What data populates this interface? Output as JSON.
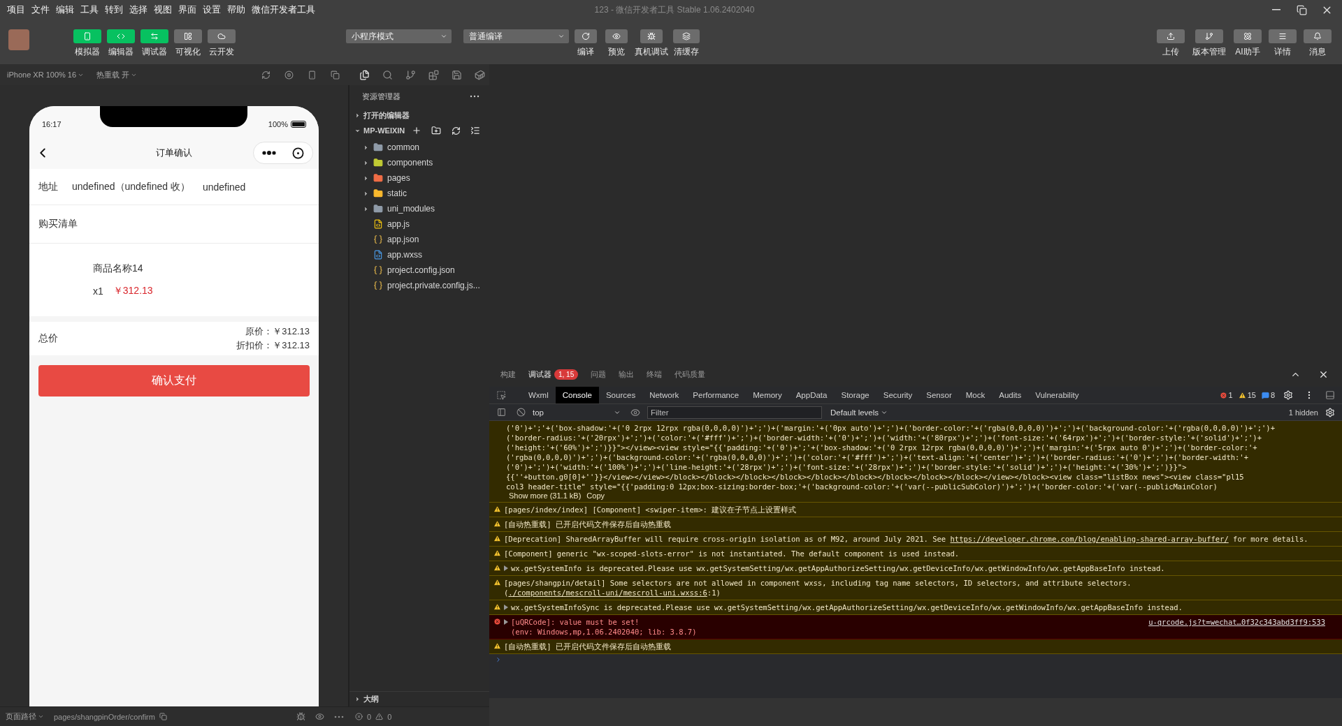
{
  "menu_bar": {
    "items": [
      "项目",
      "文件",
      "编辑",
      "工具",
      "转到",
      "选择",
      "视图",
      "界面",
      "设置",
      "帮助",
      "微信开发者工具"
    ],
    "title": "123 - 微信开发者工具 Stable 1.06.2402040"
  },
  "toolbar": {
    "view_buttons": [
      {
        "label": "模拟器",
        "on": true
      },
      {
        "label": "编辑器",
        "on": true
      },
      {
        "label": "调试器",
        "on": true
      },
      {
        "label": "可视化",
        "on": false
      },
      {
        "label": "云开发",
        "on": false
      }
    ],
    "mode_select": "小程序模式",
    "compile_select": "普通编译",
    "actions": [
      "编译",
      "预览",
      "真机调试",
      "清缓存"
    ],
    "right_actions": [
      "上传",
      "版本管理",
      "AI助手",
      "详情",
      "消息"
    ]
  },
  "simulator": {
    "device": "iPhone XR 100% 16",
    "hot_reload": "热重载 开",
    "phone": {
      "time": "16:17",
      "battery": "100%",
      "title": "订单确认",
      "address_label": "地址",
      "address_parts": [
        "undefined（undefined 收）",
        "undefined"
      ],
      "list_title": "购买清单",
      "product": {
        "name": "商品名称14",
        "quantity": "x1",
        "price": "￥312.13"
      },
      "total_label": "总价",
      "original_price": "原价：￥312.13",
      "discount_price": "折扣价：￥312.13",
      "pay_button": "确认支付"
    }
  },
  "explorer": {
    "title": "资源管理器",
    "open_editors": {
      "label": "打开的编辑器",
      "expanded": false
    },
    "project": {
      "label": "MP-WEIXIN",
      "expanded": true
    },
    "items": [
      {
        "name": "common",
        "kind": "folder",
        "expanded": false,
        "color": "#8f9ba8"
      },
      {
        "name": "components",
        "kind": "folder",
        "expanded": false,
        "color": "#c0ca33"
      },
      {
        "name": "pages",
        "kind": "folder",
        "expanded": false,
        "color": "#ef6c45"
      },
      {
        "name": "static",
        "kind": "folder",
        "expanded": false,
        "color": "#f9b82d"
      },
      {
        "name": "uni_modules",
        "kind": "folder",
        "expanded": false,
        "color": "#8f9ba8"
      },
      {
        "name": "app.js",
        "kind": "js"
      },
      {
        "name": "app.json",
        "kind": "json"
      },
      {
        "name": "app.wxss",
        "kind": "css"
      },
      {
        "name": "project.config.json",
        "kind": "json"
      },
      {
        "name": "project.private.config.js...",
        "kind": "json"
      }
    ],
    "outline": {
      "label": "大纲",
      "expanded": false
    }
  },
  "status_bar": {
    "page_path_label": "页面路径",
    "page_path": "pages/shangpinOrder/confirm",
    "errors": "0",
    "warnings": "0"
  },
  "devtools": {
    "panel_tabs": [
      {
        "label": "构建",
        "selected": false
      },
      {
        "label": "调试器",
        "selected": true,
        "badge": "1, 15"
      },
      {
        "label": "问题",
        "selected": false
      },
      {
        "label": "输出",
        "selected": false
      },
      {
        "label": "终端",
        "selected": false
      },
      {
        "label": "代码质量",
        "selected": false
      }
    ],
    "tabs": [
      {
        "label": "Wxml",
        "selected": false
      },
      {
        "label": "Console",
        "selected": true
      },
      {
        "label": "Sources",
        "selected": false
      },
      {
        "label": "Network",
        "selected": false
      },
      {
        "label": "Performance",
        "selected": false
      },
      {
        "label": "Memory",
        "selected": false
      },
      {
        "label": "AppData",
        "selected": false
      },
      {
        "label": "Storage",
        "selected": false
      },
      {
        "label": "Security",
        "selected": false
      },
      {
        "label": "Sensor",
        "selected": false
      },
      {
        "label": "Mock",
        "selected": false
      },
      {
        "label": "Audits",
        "selected": false
      },
      {
        "label": "Vulnerability",
        "selected": false
      }
    ],
    "counts": {
      "errors": "1",
      "warnings": "15",
      "info": "8"
    },
    "context": "top",
    "filter_placeholder": "Filter",
    "levels": "Default levels",
    "hidden": "1 hidden",
    "truncated_output": {
      "lines": [
        "('0')+';'+('box-shadow:'+('0 2rpx 12rpx rgba(0,0,0,0)')+';')+('margin:'+('0px auto')+';')+('border-color:'+('rgba(0,0,0,0)')+';')+('background-color:'+('rgba(0,0,0,0)')+';')+",
        "('border-radius:'+('20rpx')+';')+('color:'+('#fff')+';')+('border-width:'+('0')+';')+('width:'+('80rpx')+';')+('font-size:'+('64rpx')+';')+('border-style:'+('solid')+';')+",
        "('height:'+('60%')+';')}}\"></view><view style=\"{{'padding:'+('0')+';'+('box-shadow:'+('0 2rpx 12rpx rgba(0,0,0,0)')+';')+('margin:'+('5rpx auto 0')+';')+('border-color:'+",
        "('rgba(0,0,0,0)')+';')+('background-color:'+('rgba(0,0,0,0)')+';')+('color:'+('#fff')+';')+('text-align:'+('center')+';')+('border-radius:'+('0')+';')+('border-width:'+",
        "('0')+';')+('width:'+('100%')+';')+('line-height:'+('28rpx')+';')+('font-size:'+('28rpx')+';')+('border-style:'+('solid')+';')+('height:'+('30%')+';')}}\">",
        "{{''+button.g0[0]+''}}</view></view></block></block></block></block></block></block></block></block></block></view></block><view class=\"listBox news\"><view class=\"pl15",
        "col3 header-title\" style=\"{{'padding:0 12px;box-sizing:border-box;'+('background-color:'+('var(--publicSubColor)')+';')+('border-color:'+('var(--publicMainColor)"
      ],
      "show_more": "Show more (31.1 kB)",
      "copy": "Copy"
    },
    "messages": [
      {
        "kind": "warning",
        "expandable": false,
        "text": "[pages/index/index] [Component] <swiper-item>: 建议在子节点上设置样式"
      },
      {
        "kind": "warning",
        "expandable": false,
        "text": "[自动热重载] 已开启代码文件保存后自动热重载"
      },
      {
        "kind": "warning",
        "expandable": false,
        "text": "[Deprecation] SharedArrayBuffer will require cross-origin isolation as of M92, around July 2021. See ",
        "link": "https://developer.chrome.com/blog/enabling-shared-array-buffer/",
        "text_after": " for more details."
      },
      {
        "kind": "warning",
        "expandable": false,
        "text": "[Component] generic \"wx-scoped-slots-error\" is not instantiated. The default component is used instead."
      },
      {
        "kind": "warning",
        "expandable": true,
        "text": "wx.getSystemInfo is deprecated.Please use wx.getSystemSetting/wx.getAppAuthorizeSetting/wx.getDeviceInfo/wx.getWindowInfo/wx.getAppBaseInfo instead."
      },
      {
        "kind": "warning",
        "expandable": false,
        "text": "[pages/shangpin/detail] Some selectors are not allowed in component wxss, including tag name selectors, ID selectors, and attribute selectors.(",
        "link": "./components/mescroll-uni/mescroll-uni.wxss:6",
        "text_after": ":1)"
      },
      {
        "kind": "warning",
        "expandable": true,
        "text": "wx.getSystemInfoSync is deprecated.Please use wx.getSystemSetting/wx.getAppAuthorizeSetting/wx.getDeviceInfo/wx.getWindowInfo/wx.getAppBaseInfo instead."
      },
      {
        "kind": "error",
        "expandable": true,
        "text": "[uQRCode]: value must be set!",
        "detail": "(env: Windows,mp,1.06.2402040; lib: 3.8.7)",
        "source": "u-qrcode.js?t=wechat…0f32c343abd3ff9:533"
      },
      {
        "kind": "warning",
        "expandable": false,
        "text": "[自动热重载] 已开启代码文件保存后自动热重载"
      }
    ]
  }
}
